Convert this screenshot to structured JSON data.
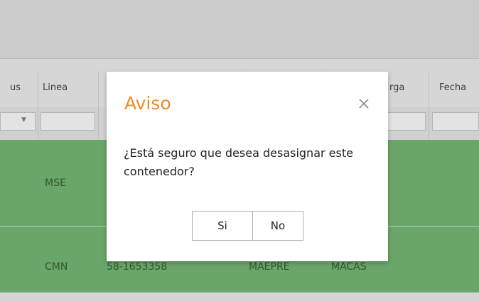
{
  "grid": {
    "columns": [
      "us",
      "Linea",
      "rga",
      "Fecha"
    ],
    "rows": [
      {
        "linea": "MSE",
        "col3": "",
        "col4": "",
        "col5": ""
      },
      {
        "linea": "CMN",
        "col3": "58-1653358",
        "col4": "MAEPRE",
        "col5": "MACAS"
      }
    ]
  },
  "dialog": {
    "title": "Aviso",
    "message": "¿Está seguro que desea desasignar este contenedor?",
    "yes_label": "Si",
    "no_label": "No"
  },
  "colors": {
    "accent": "#ef8a2a",
    "row_green": "#6aa56a"
  },
  "icons": {
    "close": "close-icon",
    "filter_dropdown": "chevron-down-icon"
  }
}
